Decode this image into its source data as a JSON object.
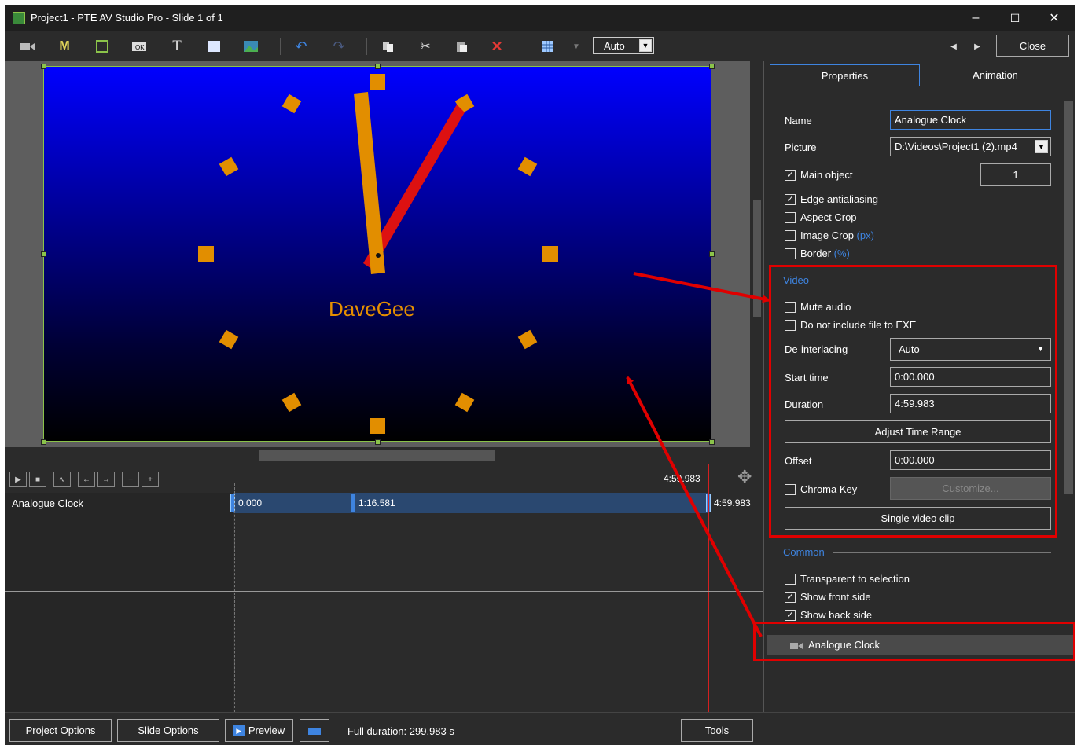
{
  "window": {
    "title": "Project1 - PTE AV Studio Pro - Slide 1 of 1",
    "minimize": "–",
    "maximize": "☐",
    "close": "✕"
  },
  "toolbar": {
    "zoom_value": "Auto",
    "close_label": "Close",
    "icons": [
      "video-camera-icon",
      "mask-icon",
      "frame-icon",
      "button-icon",
      "text-icon",
      "rectangle-icon",
      "image-icon",
      "undo-icon",
      "redo-icon",
      "copy-icon",
      "cut-icon",
      "paste-icon",
      "delete-icon",
      "grid-icon"
    ]
  },
  "slide": {
    "logo_text": "DaveGee"
  },
  "timeline": {
    "duration_marker": "4:59.983",
    "track_name": "Analogue Clock",
    "key_start": "0.000",
    "key_mid": "1:16.581",
    "key_end": "4:59.983"
  },
  "tabs": {
    "properties": "Properties",
    "animation": "Animation"
  },
  "properties": {
    "name_label": "Name",
    "name_value": "Analogue Clock",
    "picture_label": "Picture",
    "picture_value": "D:\\Videos\\Project1 (2).mp4",
    "main_object_label": "Main object",
    "main_object_value": "1",
    "edge_antialiasing": "Edge antialiasing",
    "aspect_crop": "Aspect Crop",
    "image_crop": "Image Crop",
    "image_crop_unit": "(px)",
    "border": "Border",
    "border_unit": "(%)"
  },
  "video": {
    "section": "Video",
    "mute_audio": "Mute audio",
    "no_include_exe": "Do not include file to EXE",
    "deinterlacing_label": "De-interlacing",
    "deinterlacing_value": "Auto",
    "start_time_label": "Start time",
    "start_time_value": "0:00.000",
    "duration_label": "Duration",
    "duration_value": "4:59.983",
    "adjust_time_range": "Adjust Time Range",
    "offset_label": "Offset",
    "offset_value": "0:00.000",
    "chroma_key": "Chroma Key",
    "customize": "Customize...",
    "single_video_clip": "Single video clip"
  },
  "common": {
    "section": "Common",
    "transparent_to_selection": "Transparent to selection",
    "show_front_side": "Show front side",
    "show_back_side": "Show back side"
  },
  "object_list": {
    "item": "Analogue Clock"
  },
  "statusbar": {
    "project_options": "Project Options",
    "slide_options": "Slide Options",
    "preview": "Preview",
    "full_duration": "Full duration: 299.983 s",
    "tools": "Tools"
  },
  "colors": {
    "accent_blue": "#3e84e0",
    "highlight_red": "#e00000",
    "clock_orange": "#e28e00"
  }
}
